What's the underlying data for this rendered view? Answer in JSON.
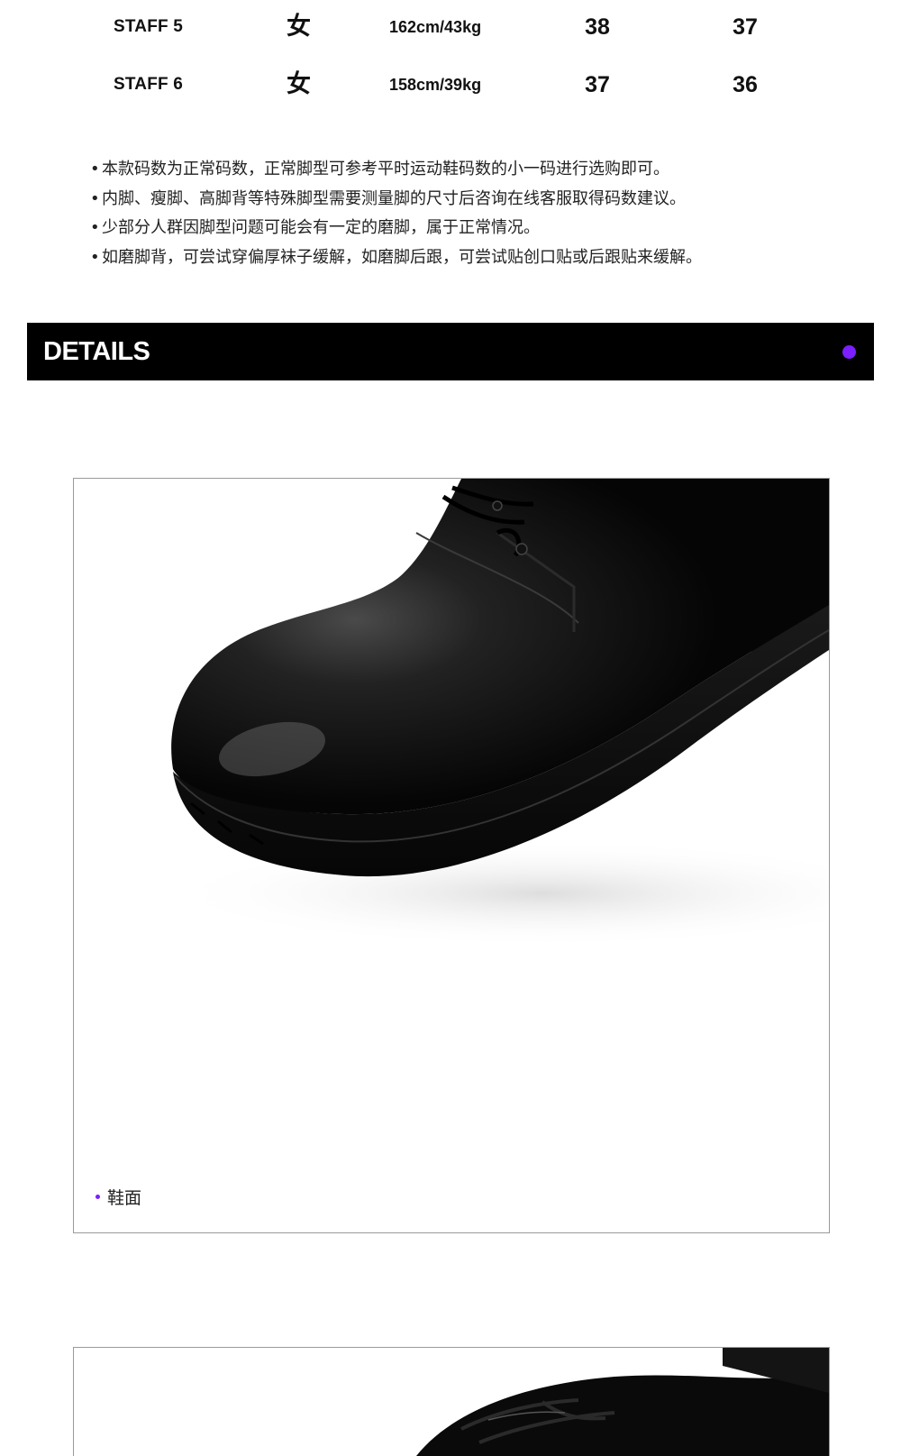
{
  "size_table": {
    "rows": [
      {
        "name": "STAFF 5",
        "gender": "女",
        "body": "162cm/43kg",
        "size_a": "38",
        "size_b": "37"
      },
      {
        "name": "STAFF 6",
        "gender": "女",
        "body": "158cm/39kg",
        "size_a": "37",
        "size_b": "36"
      }
    ]
  },
  "notes": {
    "bullet": "•",
    "items": [
      "本款码数为正常码数，正常脚型可参考平时运动鞋码数的小一码进行选购即可。",
      "内脚、瘦脚、高脚背等特殊脚型需要测量脚的尺寸后咨询在线客服取得码数建议。",
      "少部分人群因脚型问题可能会有一定的磨脚，属于正常情况。",
      "如磨脚背，可尝试穿偏厚袜子缓解，如磨脚后跟，可尝试贴创口贴或后跟贴来缓解。"
    ]
  },
  "details": {
    "title": "DETAILS",
    "accent_color": "#7b1fff"
  },
  "photos": [
    {
      "caption": "鞋面",
      "subject": "black leather derby shoe toe close-up"
    },
    {
      "caption": "",
      "subject": "black leather shoe laces close-up"
    }
  ],
  "colors": {
    "bar_bg": "#000000",
    "frame_border": "#9a9a9a",
    "caption_dot": "#7b1fff"
  }
}
